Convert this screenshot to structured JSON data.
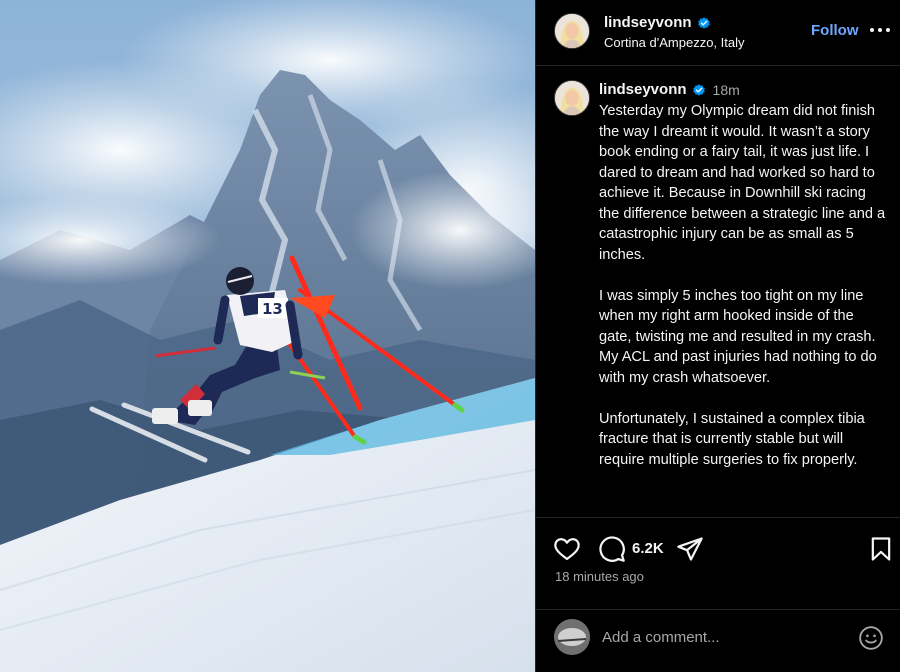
{
  "header": {
    "username": "lindseyvonn",
    "location": "Cortina d'Ampezzo, Italy",
    "follow_label": "Follow",
    "more_icon": "more-horizontal-icon",
    "verified_icon": "verified-badge-icon"
  },
  "photo": {
    "bib_number": "13"
  },
  "caption": {
    "username": "lindseyvonn",
    "time": "18m",
    "paragraphs": [
      "Yesterday my Olympic dream did not finish the way I dreamt it would. It wasn’t a story book ending or a fairy tail, it was just life. I dared to dream and had worked so hard to achieve it. Because in Downhill ski racing the difference between a strategic line and a catastrophic injury can be as small as 5 inches.",
      "I was simply 5 inches too tight on my line when my right arm hooked inside of the gate, twisting me and resulted in my crash. My ACL and past injuries had nothing to do with my crash whatsoever.",
      "Unfortunately, I sustained a complex tibia fracture that is currently stable but will require multiple surgeries to fix properly."
    ]
  },
  "actions": {
    "comment_count": "6.2K",
    "posted_ago": "18 minutes ago",
    "icons": [
      "heart-icon",
      "comment-icon",
      "share-icon",
      "bookmark-icon"
    ]
  },
  "comment_box": {
    "placeholder": "Add a comment...",
    "emoji_icon": "emoji-icon"
  },
  "colors": {
    "background": "#000000",
    "text": "#f5f5f5",
    "muted": "#a8a8a8",
    "follow_accent": "#6ea8fe",
    "verified": "#0095f6",
    "gate_red": "#ff2a1a"
  }
}
